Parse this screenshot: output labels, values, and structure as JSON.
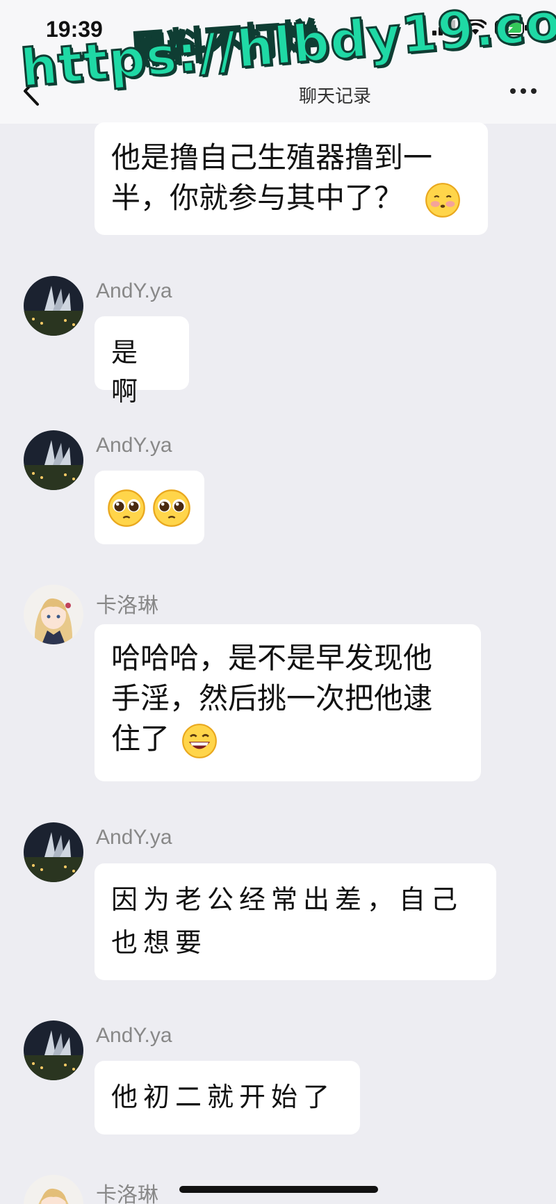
{
  "status_bar": {
    "time": "19:39"
  },
  "nav": {
    "title": "聊天记录",
    "back_icon": "chevron-left-icon",
    "more_icon": "more-dots-icon"
  },
  "watermark": {
    "line1": "黑料不打烊",
    "line2": "https://hlbdy19.com",
    "color": "#1FD9A5"
  },
  "messages": [
    {
      "sender": "",
      "lines": [
        "他是撸自己生殖器撸到一",
        "半，你就参与其中了？"
      ],
      "emoji": "blush-face-icon"
    },
    {
      "sender": "AndY.ya",
      "lines": [
        "是啊"
      ]
    },
    {
      "sender": "AndY.ya",
      "emojis": [
        "pleading-face-icon",
        "pleading-face-icon"
      ]
    },
    {
      "sender": "卡洛琳",
      "lines": [
        "哈哈哈，是不是早发现他",
        "手淫，然后挑一次把他逮",
        "住了"
      ],
      "emoji": "grinning-face-icon"
    },
    {
      "sender": "AndY.ya",
      "lines": [
        "因为老公经常出差，自己",
        "也想要"
      ]
    },
    {
      "sender": "AndY.ya",
      "lines": [
        "他初二就开始了"
      ]
    },
    {
      "sender": "卡洛琳"
    }
  ]
}
